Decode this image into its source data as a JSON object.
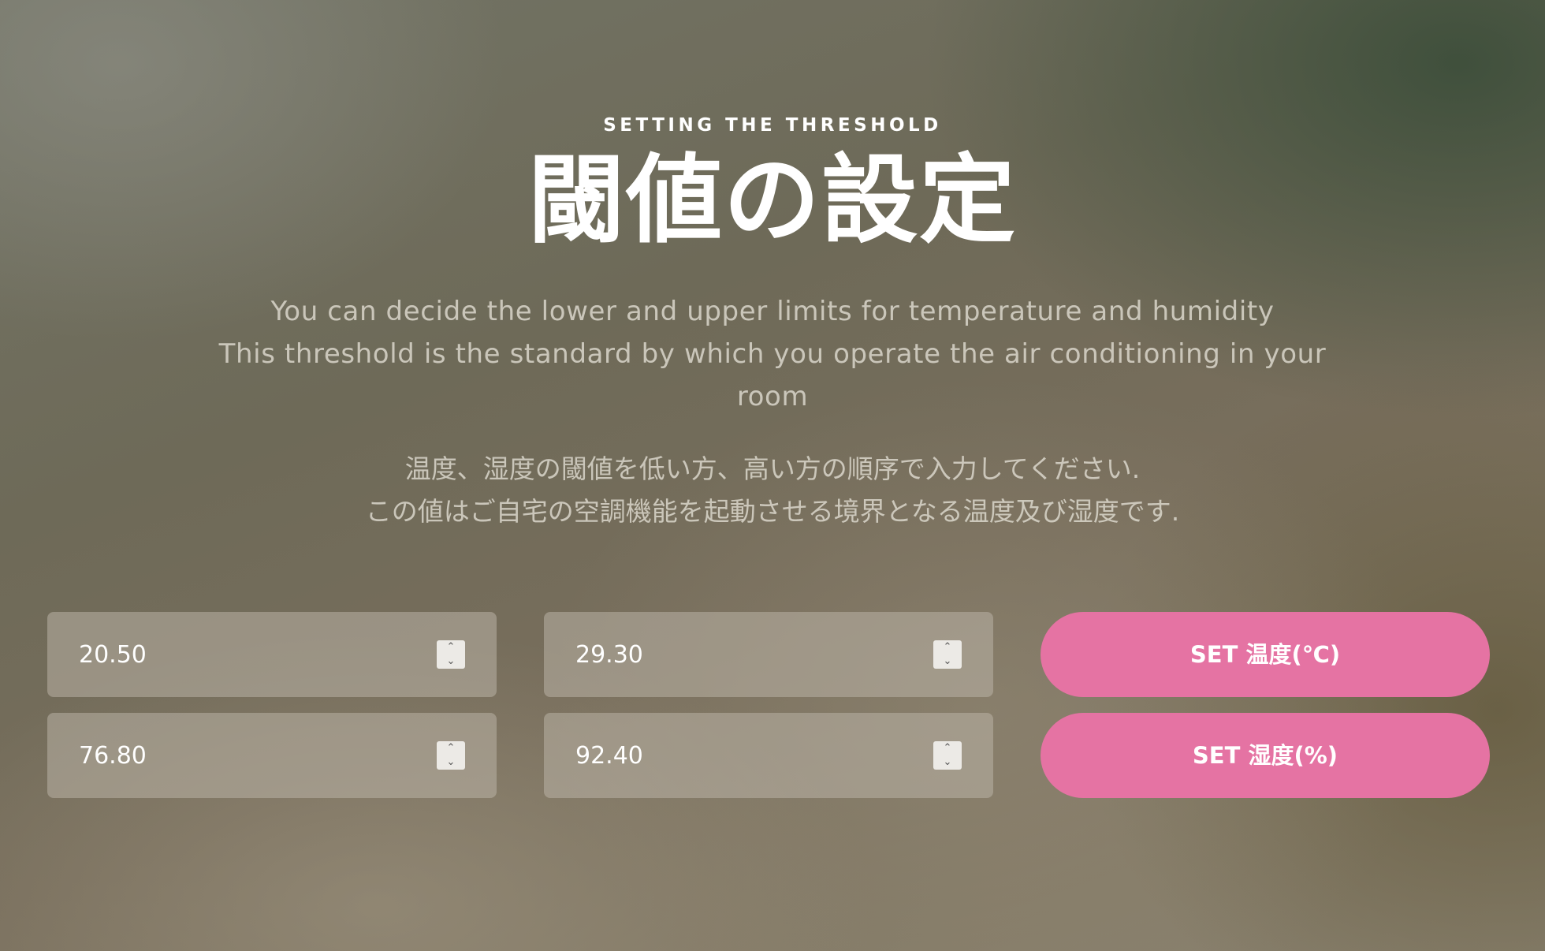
{
  "header": {
    "eyebrow": "SETTING THE THRESHOLD",
    "title": "閾値の設定"
  },
  "description": {
    "en_lines": [
      "You can decide the lower and upper limits for temperature and humidity",
      "This threshold is the standard by which you operate the air conditioning in your",
      "room"
    ],
    "jp_lines": [
      "温度、湿度の閾値を低い方、高い方の順序で入力してください.",
      "この値はご自宅の空調機能を起動させる境界となる温度及び湿度です."
    ]
  },
  "form": {
    "temperature": {
      "low_value": "20.50",
      "high_value": "29.30",
      "button_label": "SET 温度(℃)"
    },
    "humidity": {
      "low_value": "76.80",
      "high_value": "92.40",
      "button_label": "SET 湿度(%)"
    }
  },
  "colors": {
    "button_bg": "#e573a3",
    "field_bg": "rgba(185,178,165,0.55)",
    "text_primary": "#ffffff"
  },
  "icons": {
    "spinner": "number-spinner-icon"
  }
}
